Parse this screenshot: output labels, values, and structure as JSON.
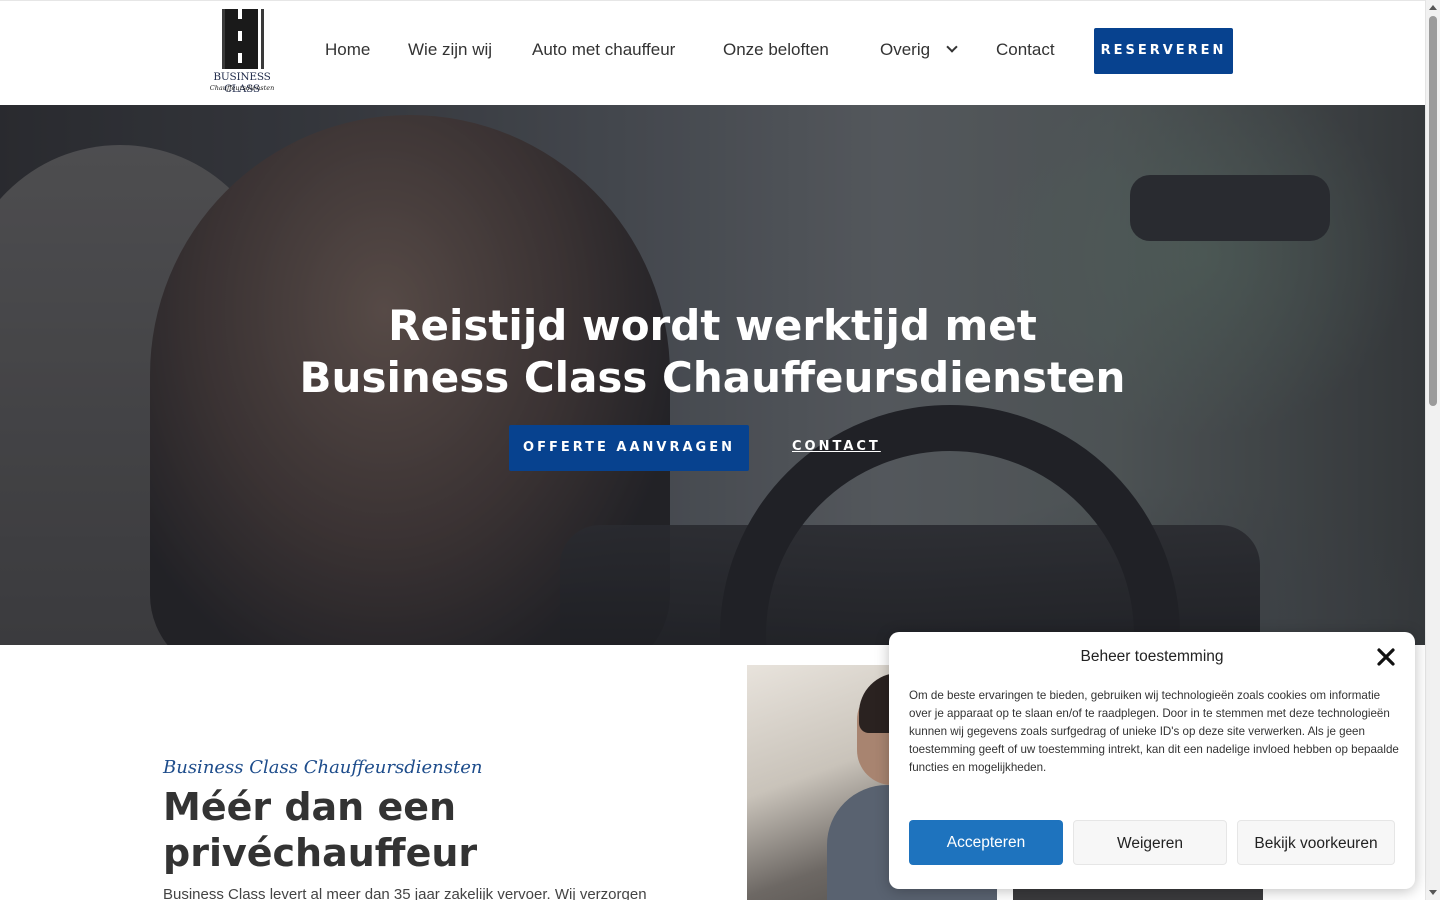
{
  "brand": {
    "logo_title": "BUSINESS CLASS",
    "logo_subtitle": "Chauffeursdiensten"
  },
  "nav": {
    "items": [
      {
        "label": "Home"
      },
      {
        "label": "Wie zijn wij"
      },
      {
        "label": "Auto met chauffeur"
      },
      {
        "label": "Onze beloften"
      },
      {
        "label": "Overig",
        "has_dropdown": true,
        "icon": "chevron-down-icon"
      },
      {
        "label": "Contact"
      }
    ],
    "cta_label": "RESERVEREN"
  },
  "hero": {
    "title_line1": "Reistijd wordt werktijd met",
    "title_line2": "Business Class Chauffeursdiensten",
    "primary_button": "OFFERTE AANVRAGEN",
    "secondary_link": "CONTACT"
  },
  "intro": {
    "kicker": "Business Class Chauffeursdiensten",
    "title": "Méér dan een privéchauffeur",
    "text": "Business Class levert al meer dan 35 jaar zakelijk vervoer. Wij verzorgen"
  },
  "consent": {
    "title": "Beheer toestemming",
    "close_icon": "close-icon",
    "message": "Om de beste ervaringen te bieden, gebruiken wij technologieën zoals cookies om informatie over je apparaat op te slaan en/of te raadplegen. Door in te stemmen met deze technologieën kunnen wij gegevens zoals surfgedrag of unieke ID's op deze site verwerken. Als je geen toestemming geeft of uw toestemming intrekt, kan dit een nadelige invloed hebben op bepaalde functies en mogelijkheden.",
    "accept_label": "Accepteren",
    "deny_label": "Weigeren",
    "prefs_label": "Bekijk voorkeuren"
  },
  "colors": {
    "brand_blue": "#07428f",
    "consent_accept_blue": "#1e73be",
    "kicker_blue": "#1d4c8b",
    "text_dark": "#333333"
  }
}
